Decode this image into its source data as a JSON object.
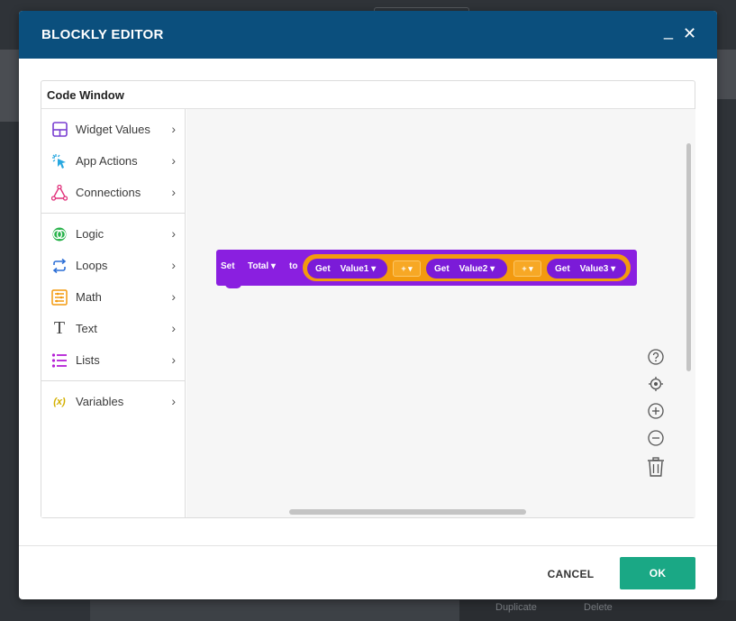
{
  "dialog": {
    "title": "BLOCKLY EDITOR",
    "minimize_glyph": "_",
    "close_glyph": "✕"
  },
  "code_window": {
    "title": "Code Window"
  },
  "toolbox": {
    "items": [
      {
        "label": "Widget Values",
        "icon": "widget-values-icon",
        "color": "#7a3fd1"
      },
      {
        "label": "App Actions",
        "icon": "app-actions-icon",
        "color": "#29a8e0"
      },
      {
        "label": "Connections",
        "icon": "connections-icon",
        "color": "#e0307a"
      },
      {
        "label": "Logic",
        "icon": "logic-icon",
        "color": "#27b24a"
      },
      {
        "label": "Loops",
        "icon": "loops-icon",
        "color": "#2c6fd6"
      },
      {
        "label": "Math",
        "icon": "math-icon",
        "color": "#f39a0f"
      },
      {
        "label": "Text",
        "icon": "text-icon",
        "color": "#444444"
      },
      {
        "label": "Lists",
        "icon": "lists-icon",
        "color": "#b51fd6"
      },
      {
        "label": "Variables",
        "icon": "variables-icon",
        "color": "#d4b000"
      }
    ],
    "variables_glyph": "(x)"
  },
  "block": {
    "set_label": "Set",
    "variable": "Total",
    "to_label": "to",
    "get1_label": "Get",
    "get1_value": "Value1",
    "op1": "+",
    "get2_label": "Get",
    "get2_value": "Value2",
    "op2": "+",
    "get3_label": "Get",
    "get3_value": "Value3",
    "colors": {
      "block": "#8a1fe0",
      "expression": "#f39a0f"
    }
  },
  "footer": {
    "cancel_label": "CANCEL",
    "ok_label": "OK"
  },
  "background": {
    "duplicate_label": "Duplicate",
    "delete_label": "Delete"
  },
  "colors": {
    "header": "#0b4f7d",
    "ok_button": "#1aa885"
  }
}
